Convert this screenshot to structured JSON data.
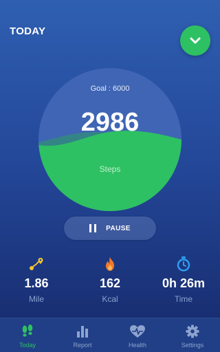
{
  "header": {
    "title": "TODAY"
  },
  "progress": {
    "goal_text": "Goal : 6000",
    "steps_value": "2986",
    "steps_label": "Steps",
    "fraction": 0.498
  },
  "pause_button": {
    "label": "PAUSE"
  },
  "stats": [
    {
      "value": "1.86",
      "label": "Mile",
      "icon": "map-route-icon"
    },
    {
      "value": "162",
      "label": "Kcal",
      "icon": "flame-icon"
    },
    {
      "value": "0h 26m",
      "label": "Time",
      "icon": "stopwatch-icon"
    }
  ],
  "tabs": [
    {
      "label": "Today",
      "icon": "footprints-icon",
      "active": true
    },
    {
      "label": "Report",
      "icon": "bar-chart-icon",
      "active": false
    },
    {
      "label": "Health",
      "icon": "heart-pulse-icon",
      "active": false
    },
    {
      "label": "Settings",
      "icon": "gear-icon",
      "active": false
    }
  ],
  "colors": {
    "accent": "#2ec163",
    "background": "#24489a",
    "stat_icon_yellow": "#f4c430",
    "stat_icon_orange": "#f07a28",
    "stat_icon_blue": "#2e9ef0"
  }
}
